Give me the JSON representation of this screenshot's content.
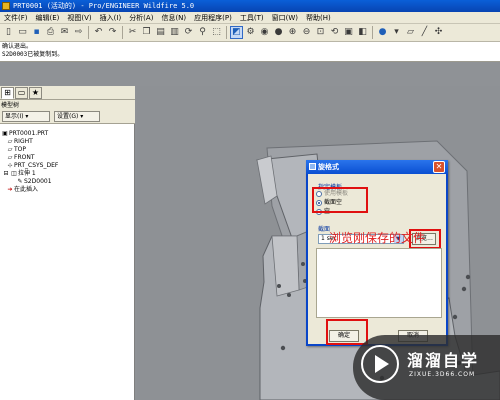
{
  "window": {
    "title": "PRT0001 (活动的) - Pro/ENGINEER Wildfire 5.0"
  },
  "menu": [
    "文件(F)",
    "编辑(E)",
    "视图(V)",
    "插入(I)",
    "分析(A)",
    "信息(N)",
    "应用程序(P)",
    "工具(T)",
    "窗口(W)",
    "帮助(H)"
  ],
  "messages": [
    "确认退出。",
    "S2D0003已被复制到。",
    "确认退出。"
  ],
  "tree": {
    "header_label": "模型树",
    "show_button": "显示(I) ▾",
    "settings_button": "设置(G) ▾",
    "items": [
      {
        "label": "PRT0001.PRT",
        "icon": "part-icon"
      },
      {
        "label": "RIGHT",
        "icon": "datum-plane-icon"
      },
      {
        "label": "TOP",
        "icon": "datum-plane-icon"
      },
      {
        "label": "FRONT",
        "icon": "datum-plane-icon"
      },
      {
        "label": "PRT_CSYS_DEF",
        "icon": "csys-icon"
      },
      {
        "label": "拉伸 1",
        "icon": "extrude-icon"
      },
      {
        "label": "S2D0001",
        "icon": "sketch-icon"
      },
      {
        "label": "在此插入",
        "icon": "insert-arrow-icon"
      }
    ]
  },
  "dialog": {
    "title": "旋格式",
    "close": "✕",
    "group_label": "指定模板",
    "option_use_template": "使用模板",
    "option_empty_section": "截面空",
    "option_empty": "空",
    "section_label": "截面",
    "section_value": "1 sec",
    "browse_label": "浏览...",
    "ok_label": "确定",
    "cancel_label": "取消"
  },
  "annotation": "浏览刚保存的文件",
  "watermark": {
    "main": "溜溜自学",
    "sub": "ZIXUE.3D66.COM"
  },
  "colors": {
    "title_bar": "#0a4fd1",
    "annotation_red": "#e02020",
    "highlight_red": "#e01010",
    "background_gray": "#8e9195"
  }
}
